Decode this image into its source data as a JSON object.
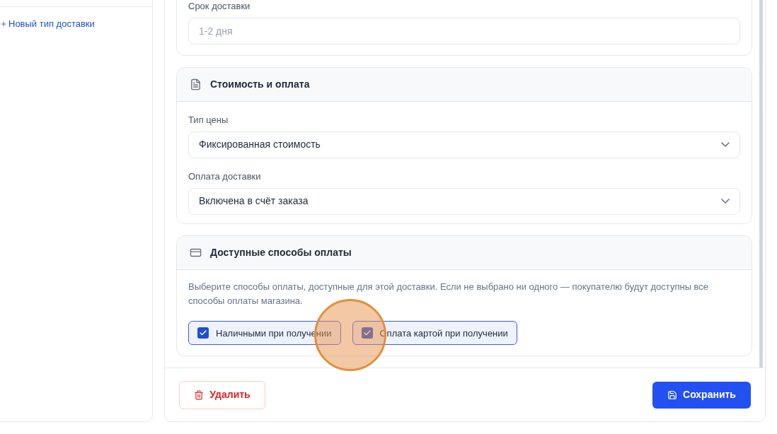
{
  "sidebar": {
    "new_link": "Новый тип доставки"
  },
  "cards": [
    {
      "kind": "fields",
      "fields": [
        {
          "label": "Срок доставки",
          "kind": "input",
          "placeholder": "1-2 дня"
        }
      ]
    },
    {
      "kind": "fields",
      "title": "Стоимость и оплата",
      "fields": [
        {
          "label": "Тип цены",
          "kind": "select",
          "value": "Фиксированная стоимость"
        },
        {
          "label": "Оплата доставки",
          "kind": "select",
          "value": "Включена в счёт заказа"
        }
      ]
    },
    {
      "kind": "checks",
      "title": "Доступные способы оплаты",
      "description": "Выберите способы оплаты, доступные для этой доставки. Если не выбрано ни одного — покупателю будут доступны все способы оплаты магазина.",
      "options": [
        {
          "label": "Наличными при получении",
          "checked": true
        },
        {
          "label": "Оплата картой при получении",
          "checked": true
        }
      ]
    }
  ],
  "footer": {
    "delete": "Удалить",
    "save": "Сохранить"
  }
}
